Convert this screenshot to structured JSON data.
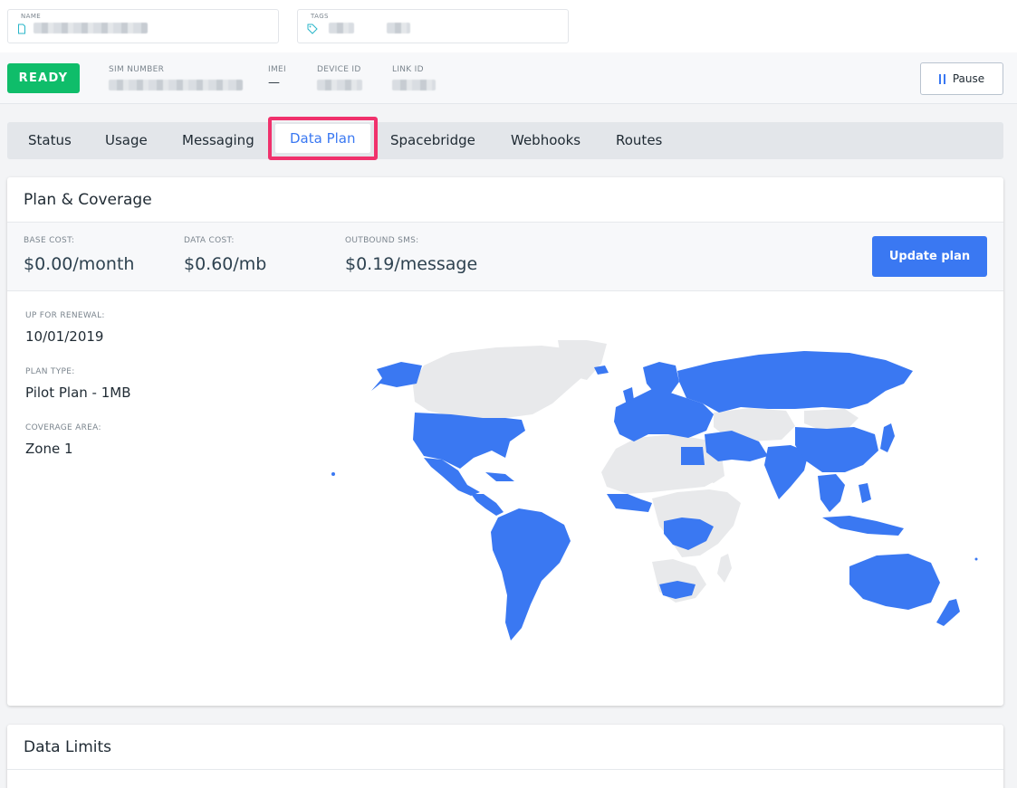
{
  "top_fields": {
    "name_label": "NAME",
    "tags_label": "TAGS"
  },
  "status": {
    "badge": "READY",
    "sim_number_label": "SIM NUMBER",
    "imei_label": "IMEI",
    "imei_value": "—",
    "device_id_label": "DEVICE ID",
    "link_id_label": "LINK ID",
    "pause_label": "Pause"
  },
  "tabs": [
    "Status",
    "Usage",
    "Messaging",
    "Data Plan",
    "Spacebridge",
    "Webhooks",
    "Routes"
  ],
  "active_tab": "Data Plan",
  "plan": {
    "title": "Plan & Coverage",
    "base_cost_label": "BASE COST:",
    "base_cost_value": "$0.00/month",
    "data_cost_label": "DATA COST:",
    "data_cost_value": "$0.60/mb",
    "sms_label": "OUTBOUND SMS:",
    "sms_value": "$0.19/message",
    "update_label": "Update plan",
    "renewal_label": "UP FOR RENEWAL:",
    "renewal_value": "10/01/2019",
    "plan_type_label": "PLAN TYPE:",
    "plan_type_value": "Pilot Plan - 1MB",
    "coverage_label": "COVERAGE AREA:",
    "coverage_value": "Zone 1"
  },
  "limits": {
    "title": "Data Limits"
  },
  "colors": {
    "accent": "#3a78f2",
    "ready": "#0fbd6a",
    "highlight": "#f0316c",
    "map_covered": "#3a78f2",
    "map_uncovered": "#e8e9eb"
  }
}
